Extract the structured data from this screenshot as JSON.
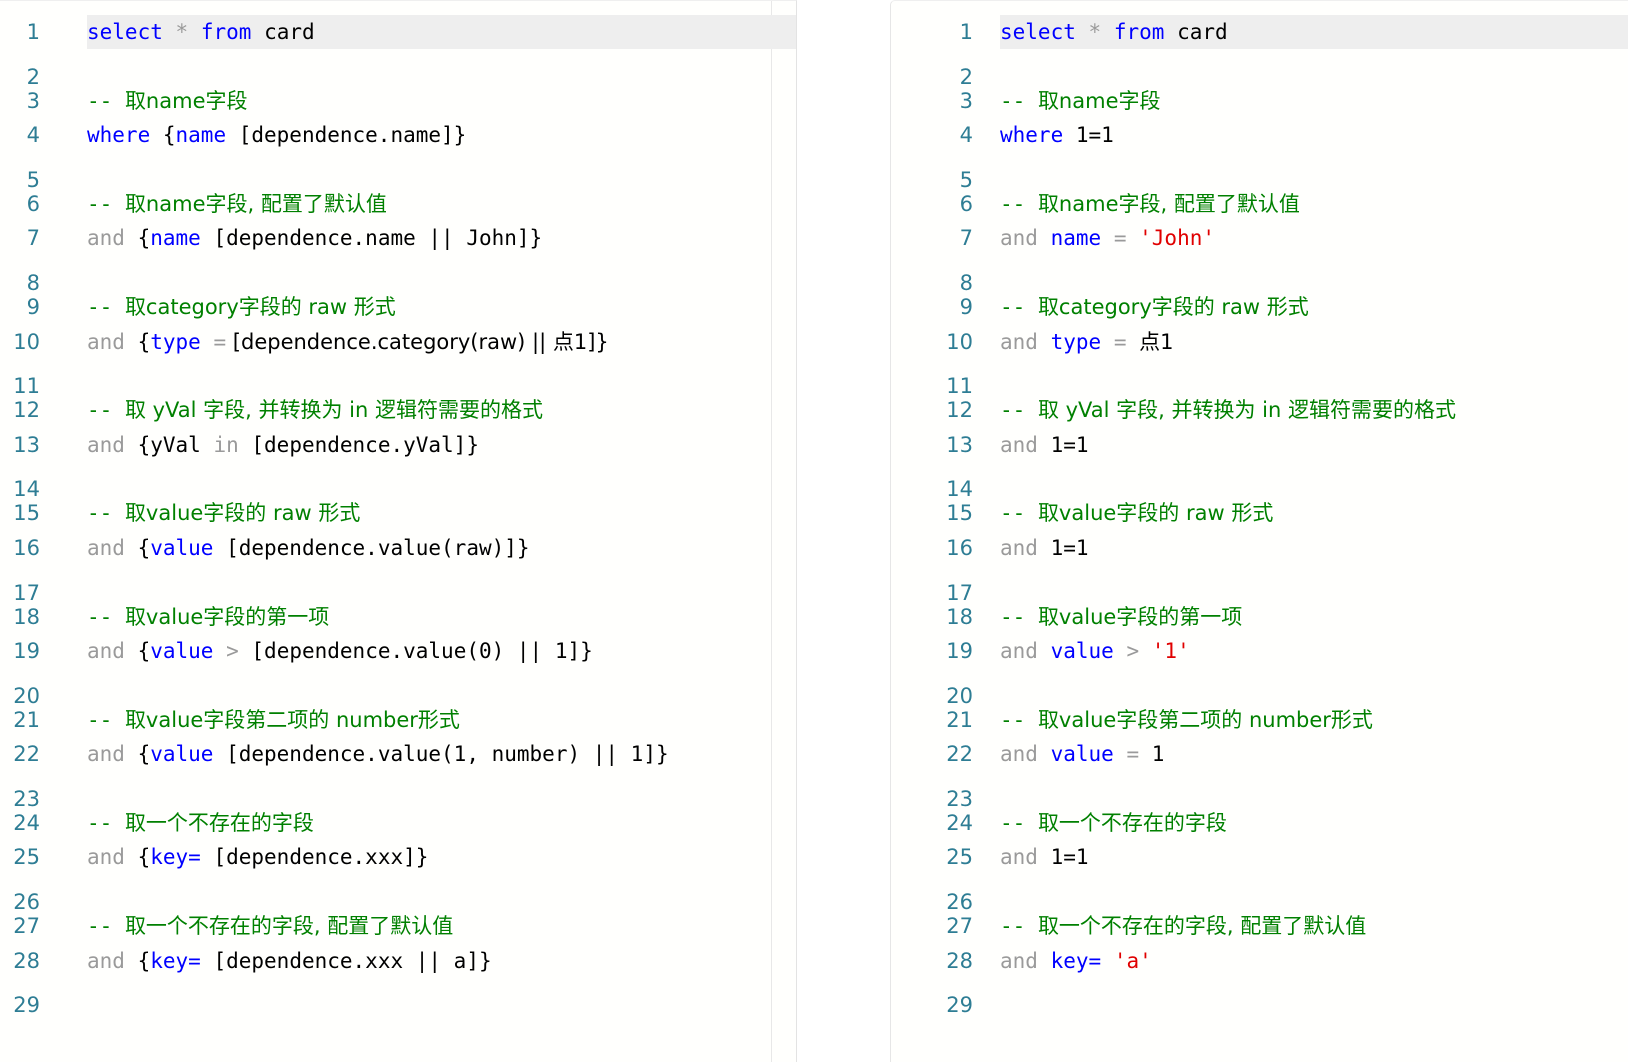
{
  "meta": {
    "editor_background": "#fffffd",
    "active_line_highlight": "#eeeeee",
    "gutter_color": "#2e7d94",
    "keyword_color": "#0000ff",
    "comment_color": "#008000",
    "string_color": "#e00000",
    "operator_color": "#9a9a9a",
    "plain_color": "#000000",
    "active_line_number": 1
  },
  "panels": [
    {
      "id": "left-editor",
      "name": "template-sql-editor",
      "lines": [
        {
          "n": "1",
          "tokens": [
            {
              "t": "select",
              "c": "keyword"
            },
            {
              "t": " ",
              "c": "plain"
            },
            {
              "t": "*",
              "c": "star"
            },
            {
              "t": " ",
              "c": "plain"
            },
            {
              "t": "from",
              "c": "keyword"
            },
            {
              "t": " ",
              "c": "plain"
            },
            {
              "t": "card",
              "c": "plain"
            }
          ]
        },
        {
          "n": "2",
          "tokens": []
        },
        {
          "n": "3",
          "tokens": [
            {
              "t": "-- ",
              "c": "comment"
            },
            {
              "t": "取name字段",
              "c": "comment"
            }
          ]
        },
        {
          "n": "4",
          "tokens": [
            {
              "t": "where",
              "c": "keyword"
            },
            {
              "t": " {",
              "c": "plain"
            },
            {
              "t": "name",
              "c": "ident"
            },
            {
              "t": " [dependence.name]}",
              "c": "plain"
            }
          ]
        },
        {
          "n": "5",
          "tokens": []
        },
        {
          "n": "6",
          "tokens": [
            {
              "t": "-- ",
              "c": "comment"
            },
            {
              "t": "取name字段, 配置了默认值",
              "c": "comment"
            }
          ]
        },
        {
          "n": "7",
          "tokens": [
            {
              "t": "and",
              "c": "and"
            },
            {
              "t": " {",
              "c": "plain"
            },
            {
              "t": "name",
              "c": "ident"
            },
            {
              "t": " [dependence.name || John]}",
              "c": "plain"
            }
          ]
        },
        {
          "n": "8",
          "tokens": []
        },
        {
          "n": "9",
          "tokens": [
            {
              "t": "-- ",
              "c": "comment"
            },
            {
              "t": "取category字段的 raw 形式",
              "c": "comment"
            }
          ]
        },
        {
          "n": "10",
          "tokens": [
            {
              "t": "and",
              "c": "and"
            },
            {
              "t": " {",
              "c": "plain"
            },
            {
              "t": "type",
              "c": "ident"
            },
            {
              "t": " ",
              "c": "plain"
            },
            {
              "t": "=",
              "c": "op"
            },
            {
              "t": " [dependence.category(raw) || 点1]}",
              "c": "plain"
            }
          ]
        },
        {
          "n": "11",
          "tokens": []
        },
        {
          "n": "12",
          "tokens": [
            {
              "t": "-- ",
              "c": "comment"
            },
            {
              "t": "取 yVal 字段, 并转换为 in 逻辑符需要的格式",
              "c": "comment"
            }
          ]
        },
        {
          "n": "13",
          "tokens": [
            {
              "t": "and",
              "c": "and"
            },
            {
              "t": " {yVal ",
              "c": "plain"
            },
            {
              "t": "in",
              "c": "and"
            },
            {
              "t": " [dependence.yVal]}",
              "c": "plain"
            }
          ]
        },
        {
          "n": "14",
          "tokens": []
        },
        {
          "n": "15",
          "tokens": [
            {
              "t": "-- ",
              "c": "comment"
            },
            {
              "t": "取value字段的 raw 形式",
              "c": "comment"
            }
          ]
        },
        {
          "n": "16",
          "tokens": [
            {
              "t": "and",
              "c": "and"
            },
            {
              "t": " {",
              "c": "plain"
            },
            {
              "t": "value",
              "c": "ident"
            },
            {
              "t": " [dependence.value(raw)]}",
              "c": "plain"
            }
          ]
        },
        {
          "n": "17",
          "tokens": []
        },
        {
          "n": "18",
          "tokens": [
            {
              "t": "-- ",
              "c": "comment"
            },
            {
              "t": "取value字段的第一项",
              "c": "comment"
            }
          ]
        },
        {
          "n": "19",
          "tokens": [
            {
              "t": "and",
              "c": "and"
            },
            {
              "t": " {",
              "c": "plain"
            },
            {
              "t": "value",
              "c": "ident"
            },
            {
              "t": " ",
              "c": "plain"
            },
            {
              "t": ">",
              "c": "op"
            },
            {
              "t": " [dependence.value(0) || 1]}",
              "c": "plain"
            }
          ]
        },
        {
          "n": "20",
          "tokens": []
        },
        {
          "n": "21",
          "tokens": [
            {
              "t": "-- ",
              "c": "comment"
            },
            {
              "t": "取value字段第二项的 number形式",
              "c": "comment"
            }
          ]
        },
        {
          "n": "22",
          "tokens": [
            {
              "t": "and",
              "c": "and"
            },
            {
              "t": " {",
              "c": "plain"
            },
            {
              "t": "value",
              "c": "ident"
            },
            {
              "t": " [dependence.value(1, number) || 1]}",
              "c": "plain"
            }
          ]
        },
        {
          "n": "23",
          "tokens": []
        },
        {
          "n": "24",
          "tokens": [
            {
              "t": "-- ",
              "c": "comment"
            },
            {
              "t": "取一个不存在的字段",
              "c": "comment"
            }
          ]
        },
        {
          "n": "25",
          "tokens": [
            {
              "t": "and",
              "c": "and"
            },
            {
              "t": " {",
              "c": "plain"
            },
            {
              "t": "key=",
              "c": "ident"
            },
            {
              "t": " [dependence.xxx]}",
              "c": "plain"
            }
          ]
        },
        {
          "n": "26",
          "tokens": []
        },
        {
          "n": "27",
          "tokens": [
            {
              "t": "-- ",
              "c": "comment"
            },
            {
              "t": "取一个不存在的字段, 配置了默认值",
              "c": "comment"
            }
          ]
        },
        {
          "n": "28",
          "tokens": [
            {
              "t": "and",
              "c": "and"
            },
            {
              "t": " {",
              "c": "plain"
            },
            {
              "t": "key=",
              "c": "ident"
            },
            {
              "t": " [dependence.xxx || a]}",
              "c": "plain"
            }
          ]
        },
        {
          "n": "29",
          "tokens": []
        }
      ]
    },
    {
      "id": "right-editor",
      "name": "rendered-sql-editor",
      "lines": [
        {
          "n": "1",
          "tokens": [
            {
              "t": "select",
              "c": "keyword"
            },
            {
              "t": " ",
              "c": "plain"
            },
            {
              "t": "*",
              "c": "star"
            },
            {
              "t": " ",
              "c": "plain"
            },
            {
              "t": "from",
              "c": "keyword"
            },
            {
              "t": " ",
              "c": "plain"
            },
            {
              "t": "card",
              "c": "plain"
            }
          ]
        },
        {
          "n": "2",
          "tokens": []
        },
        {
          "n": "3",
          "tokens": [
            {
              "t": "-- ",
              "c": "comment"
            },
            {
              "t": "取name字段",
              "c": "comment"
            }
          ]
        },
        {
          "n": "4",
          "tokens": [
            {
              "t": "where",
              "c": "keyword"
            },
            {
              "t": " ",
              "c": "plain"
            },
            {
              "t": "1=1",
              "c": "plain"
            }
          ]
        },
        {
          "n": "5",
          "tokens": []
        },
        {
          "n": "6",
          "tokens": [
            {
              "t": "-- ",
              "c": "comment"
            },
            {
              "t": "取name字段, 配置了默认值",
              "c": "comment"
            }
          ]
        },
        {
          "n": "7",
          "tokens": [
            {
              "t": "and",
              "c": "and"
            },
            {
              "t": " ",
              "c": "plain"
            },
            {
              "t": "name",
              "c": "ident"
            },
            {
              "t": " ",
              "c": "plain"
            },
            {
              "t": "=",
              "c": "op"
            },
            {
              "t": " ",
              "c": "plain"
            },
            {
              "t": "'John'",
              "c": "string"
            }
          ]
        },
        {
          "n": "8",
          "tokens": []
        },
        {
          "n": "9",
          "tokens": [
            {
              "t": "-- ",
              "c": "comment"
            },
            {
              "t": "取category字段的 raw 形式",
              "c": "comment"
            }
          ]
        },
        {
          "n": "10",
          "tokens": [
            {
              "t": "and",
              "c": "and"
            },
            {
              "t": " ",
              "c": "plain"
            },
            {
              "t": "type",
              "c": "ident"
            },
            {
              "t": " ",
              "c": "plain"
            },
            {
              "t": "=",
              "c": "op"
            },
            {
              "t": " ",
              "c": "plain"
            },
            {
              "t": "点1",
              "c": "plain"
            }
          ]
        },
        {
          "n": "11",
          "tokens": []
        },
        {
          "n": "12",
          "tokens": [
            {
              "t": "-- ",
              "c": "comment"
            },
            {
              "t": "取 yVal 字段, 并转换为 in 逻辑符需要的格式",
              "c": "comment"
            }
          ]
        },
        {
          "n": "13",
          "tokens": [
            {
              "t": "and",
              "c": "and"
            },
            {
              "t": " ",
              "c": "plain"
            },
            {
              "t": "1=1",
              "c": "plain"
            }
          ]
        },
        {
          "n": "14",
          "tokens": []
        },
        {
          "n": "15",
          "tokens": [
            {
              "t": "-- ",
              "c": "comment"
            },
            {
              "t": "取value字段的 raw 形式",
              "c": "comment"
            }
          ]
        },
        {
          "n": "16",
          "tokens": [
            {
              "t": "and",
              "c": "and"
            },
            {
              "t": " ",
              "c": "plain"
            },
            {
              "t": "1=1",
              "c": "plain"
            }
          ]
        },
        {
          "n": "17",
          "tokens": []
        },
        {
          "n": "18",
          "tokens": [
            {
              "t": "-- ",
              "c": "comment"
            },
            {
              "t": "取value字段的第一项",
              "c": "comment"
            }
          ]
        },
        {
          "n": "19",
          "tokens": [
            {
              "t": "and",
              "c": "and"
            },
            {
              "t": " ",
              "c": "plain"
            },
            {
              "t": "value",
              "c": "ident"
            },
            {
              "t": " ",
              "c": "plain"
            },
            {
              "t": ">",
              "c": "op"
            },
            {
              "t": " ",
              "c": "plain"
            },
            {
              "t": "'1'",
              "c": "string"
            }
          ]
        },
        {
          "n": "20",
          "tokens": []
        },
        {
          "n": "21",
          "tokens": [
            {
              "t": "-- ",
              "c": "comment"
            },
            {
              "t": "取value字段第二项的 number形式",
              "c": "comment"
            }
          ]
        },
        {
          "n": "22",
          "tokens": [
            {
              "t": "and",
              "c": "and"
            },
            {
              "t": " ",
              "c": "plain"
            },
            {
              "t": "value",
              "c": "ident"
            },
            {
              "t": " ",
              "c": "plain"
            },
            {
              "t": "=",
              "c": "op"
            },
            {
              "t": " ",
              "c": "plain"
            },
            {
              "t": "1",
              "c": "plain"
            }
          ]
        },
        {
          "n": "23",
          "tokens": []
        },
        {
          "n": "24",
          "tokens": [
            {
              "t": "-- ",
              "c": "comment"
            },
            {
              "t": "取一个不存在的字段",
              "c": "comment"
            }
          ]
        },
        {
          "n": "25",
          "tokens": [
            {
              "t": "and",
              "c": "and"
            },
            {
              "t": " ",
              "c": "plain"
            },
            {
              "t": "1=1",
              "c": "plain"
            }
          ]
        },
        {
          "n": "26",
          "tokens": []
        },
        {
          "n": "27",
          "tokens": [
            {
              "t": "-- ",
              "c": "comment"
            },
            {
              "t": "取一个不存在的字段, 配置了默认值",
              "c": "comment"
            }
          ]
        },
        {
          "n": "28",
          "tokens": [
            {
              "t": "and",
              "c": "and"
            },
            {
              "t": " ",
              "c": "plain"
            },
            {
              "t": "key=",
              "c": "ident"
            },
            {
              "t": " ",
              "c": "plain"
            },
            {
              "t": "'a'",
              "c": "string"
            }
          ]
        },
        {
          "n": "29",
          "tokens": []
        }
      ]
    }
  ]
}
